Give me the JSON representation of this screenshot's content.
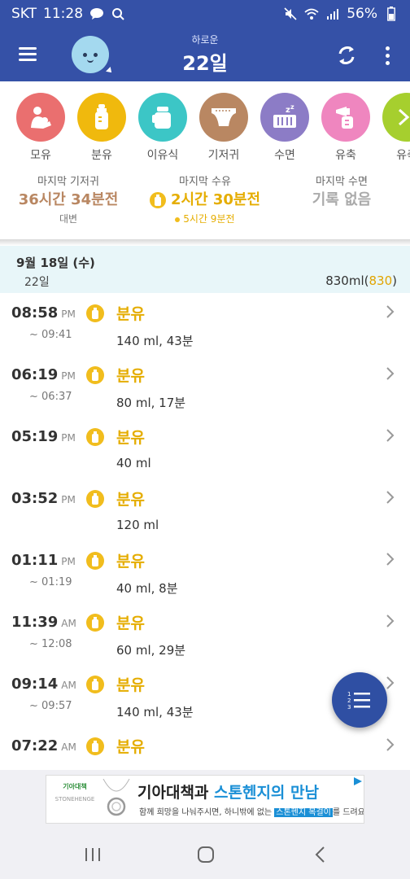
{
  "status_bar": {
    "carrier": "SKT",
    "time": "11:28",
    "battery": "56%"
  },
  "app_bar": {
    "subtitle": "하로운",
    "title": "22일"
  },
  "categories": [
    {
      "label": "모유",
      "color": "#ea6f6f",
      "icon": "breastfeeding-icon"
    },
    {
      "label": "분유",
      "color": "#f0b90d",
      "icon": "bottle-icon"
    },
    {
      "label": "이유식",
      "color": "#3cc6c6",
      "icon": "baby-food-icon"
    },
    {
      "label": "기저귀",
      "color": "#b98762",
      "icon": "diaper-icon"
    },
    {
      "label": "수면",
      "color": "#8c7cc6",
      "icon": "crib-icon"
    },
    {
      "label": "유축",
      "color": "#ef86bf",
      "icon": "breast-pump-icon"
    },
    {
      "label": "유축",
      "color": "#a6cf2e",
      "icon": "more-icon"
    }
  ],
  "summary": {
    "diaper": {
      "title": "마지막 기저귀",
      "value": "36시간 34분전",
      "sub": "대변"
    },
    "feeding": {
      "title": "마지막 수유",
      "value": "2시간 30분전",
      "sub": "5시간 9분전"
    },
    "sleep": {
      "title": "마지막 수면",
      "value": "기록 없음",
      "sub": ""
    }
  },
  "date_header": {
    "date": "9월 18일 (수)",
    "day": "22일",
    "total": "830ml",
    "total_highlight": "830"
  },
  "entries": [
    {
      "time": "08:58",
      "ampm": "PM",
      "end": "~ 09:41",
      "type": "분유",
      "detail": "140 ml, 43분"
    },
    {
      "time": "06:19",
      "ampm": "PM",
      "end": "~ 06:37",
      "type": "분유",
      "detail": "80 ml, 17분"
    },
    {
      "time": "05:19",
      "ampm": "PM",
      "end": "",
      "type": "분유",
      "detail": "40 ml"
    },
    {
      "time": "03:52",
      "ampm": "PM",
      "end": "",
      "type": "분유",
      "detail": "120 ml"
    },
    {
      "time": "01:11",
      "ampm": "PM",
      "end": "~ 01:19",
      "type": "분유",
      "detail": "40 ml, 8분"
    },
    {
      "time": "11:39",
      "ampm": "AM",
      "end": "~ 12:08",
      "type": "분유",
      "detail": "60 ml, 29분"
    },
    {
      "time": "09:14",
      "ampm": "AM",
      "end": "~ 09:57",
      "type": "분유",
      "detail": "140 ml, 43분"
    },
    {
      "time": "07:22",
      "ampm": "AM",
      "end": "",
      "type": "분유",
      "detail": ""
    }
  ],
  "ad": {
    "logo_text": "기아대책",
    "logo_sub": "STONEHENGE",
    "headline_black": "기아대책과 ",
    "headline_blue": "스톤헨지의 만남",
    "sub_before": "함께 희망을 나눠주시면, 하니밖에 없는 ",
    "sub_highlight": "스톤헨지 목걸이",
    "sub_after": "를 드려요!"
  }
}
